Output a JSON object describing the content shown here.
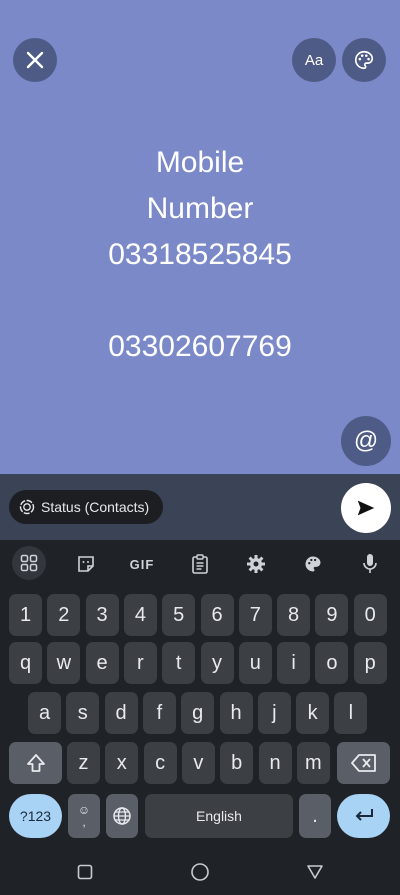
{
  "compose": {
    "background": "#7b89c8",
    "status_lines": "Mobile\nNumber\n03318525845\n\n03302607769"
  },
  "top_buttons": {
    "close_icon": "close-icon",
    "font_label": "Aa",
    "palette_icon": "palette-icon"
  },
  "mention_button": {
    "icon": "at-sign-icon"
  },
  "bottom_bar": {
    "privacy_label": "Status (Contacts)",
    "send_icon": "send-icon"
  },
  "keyboard": {
    "toolbar": [
      "apps-grid-icon",
      "sticker-icon",
      "GIF",
      "clipboard-icon",
      "settings-icon",
      "palette-icon",
      "mic-icon"
    ],
    "row_numbers": [
      "1",
      "2",
      "3",
      "4",
      "5",
      "6",
      "7",
      "8",
      "9",
      "0"
    ],
    "row_q": [
      "q",
      "w",
      "e",
      "r",
      "t",
      "y",
      "u",
      "i",
      "o",
      "p"
    ],
    "row_a": [
      "a",
      "s",
      "d",
      "f",
      "g",
      "h",
      "j",
      "k",
      "l"
    ],
    "row_z": [
      "z",
      "x",
      "c",
      "v",
      "b",
      "n",
      "m"
    ],
    "symbols_label": "?123",
    "comma_label": ",",
    "space_label": "English",
    "period_label": ".",
    "accent_color": "#a9d3f5"
  },
  "nav": [
    "recents-icon",
    "home-icon",
    "back-icon"
  ]
}
